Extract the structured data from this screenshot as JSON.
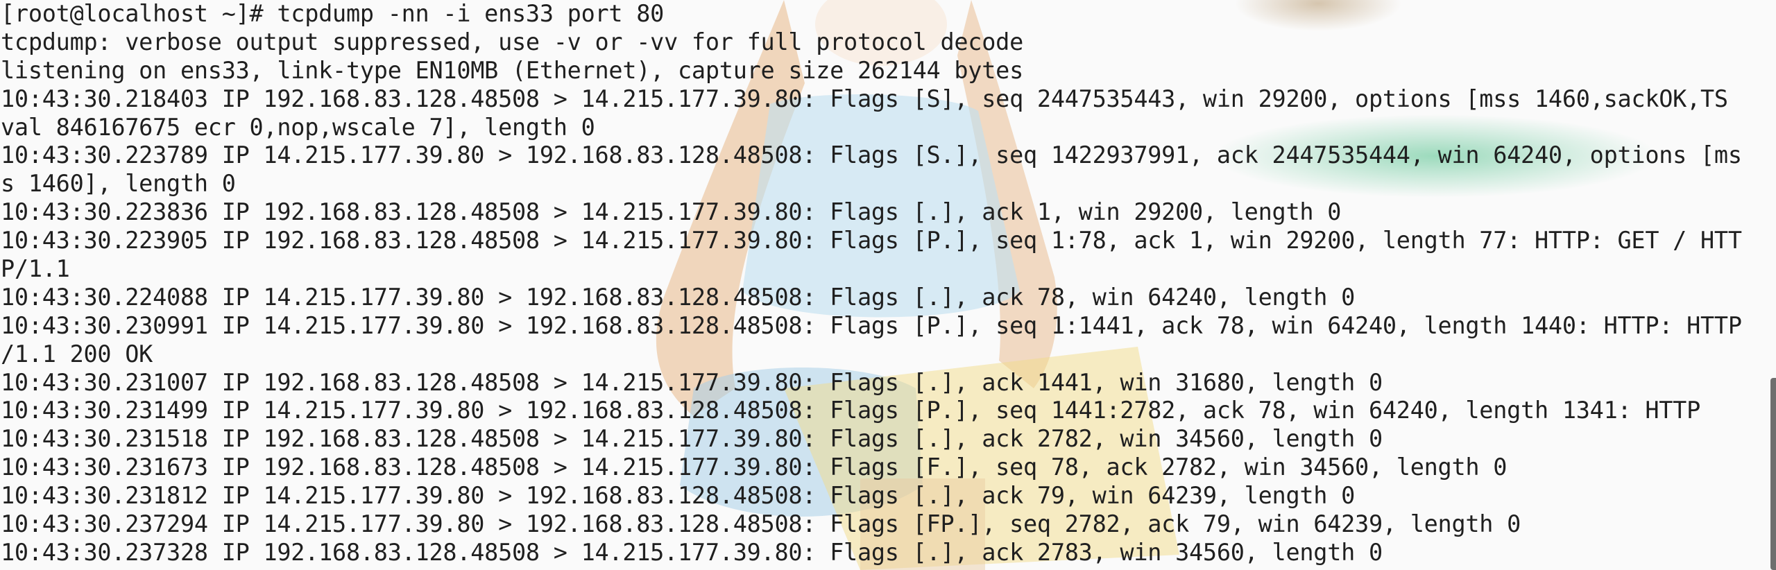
{
  "terminal": {
    "lines": [
      "[root@localhost ~]# tcpdump -nn -i ens33 port 80",
      "tcpdump: verbose output suppressed, use -v or -vv for full protocol decode",
      "listening on ens33, link-type EN10MB (Ethernet), capture size 262144 bytes",
      "10:43:30.218403 IP 192.168.83.128.48508 > 14.215.177.39.80: Flags [S], seq 2447535443, win 29200, options [mss 1460,sackOK,TS",
      "val 846167675 ecr 0,nop,wscale 7], length 0",
      "10:43:30.223789 IP 14.215.177.39.80 > 192.168.83.128.48508: Flags [S.], seq 1422937991, ack 2447535444, win 64240, options [ms",
      "s 1460], length 0",
      "10:43:30.223836 IP 192.168.83.128.48508 > 14.215.177.39.80: Flags [.], ack 1, win 29200, length 0",
      "10:43:30.223905 IP 192.168.83.128.48508 > 14.215.177.39.80: Flags [P.], seq 1:78, ack 1, win 29200, length 77: HTTP: GET / HTT",
      "P/1.1",
      "10:43:30.224088 IP 14.215.177.39.80 > 192.168.83.128.48508: Flags [.], ack 78, win 64240, length 0",
      "10:43:30.230991 IP 14.215.177.39.80 > 192.168.83.128.48508: Flags [P.], seq 1:1441, ack 78, win 64240, length 1440: HTTP: HTTP",
      "/1.1 200 OK",
      "10:43:30.231007 IP 192.168.83.128.48508 > 14.215.177.39.80: Flags [.], ack 1441, win 31680, length 0",
      "10:43:30.231499 IP 14.215.177.39.80 > 192.168.83.128.48508: Flags [P.], seq 1441:2782, ack 78, win 64240, length 1341: HTTP",
      "10:43:30.231518 IP 192.168.83.128.48508 > 14.215.177.39.80: Flags [.], ack 2782, win 34560, length 0",
      "10:43:30.231673 IP 192.168.83.128.48508 > 14.215.177.39.80: Flags [F.], seq 78, ack 2782, win 34560, length 0",
      "10:43:30.231812 IP 14.215.177.39.80 > 192.168.83.128.48508: Flags [.], ack 79, win 64239, length 0",
      "10:43:30.237294 IP 14.215.177.39.80 > 192.168.83.128.48508: Flags [FP.], seq 2782, ack 79, win 64239, length 0",
      "10:43:30.237328 IP 192.168.83.128.48508 > 14.215.177.39.80: Flags [.], ack 2783, win 34560, length 0"
    ]
  },
  "colors": {
    "background": "#fafafa",
    "text": "#1f1f1f",
    "highlight": "#4fc08a",
    "scrollbar": "#6e6e6e"
  }
}
